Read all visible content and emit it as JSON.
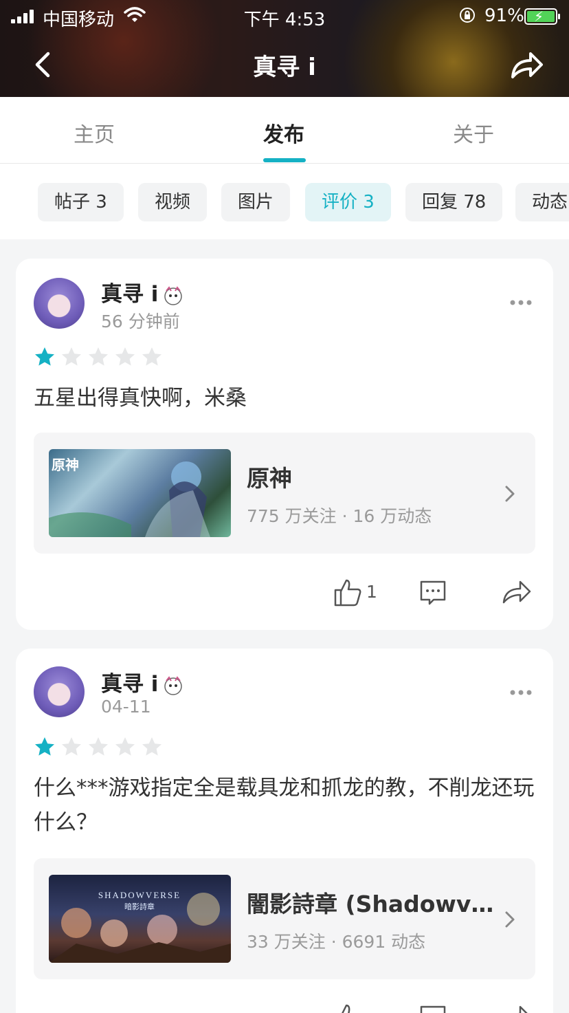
{
  "status": {
    "carrier": "中国移动",
    "time": "下午 4:53",
    "battery": "91%"
  },
  "header": {
    "title": "真寻 i"
  },
  "tabs": [
    "主页",
    "发布",
    "关于"
  ],
  "filters": [
    "帖子 3",
    "视频",
    "图片",
    "评价 3",
    "回复 78",
    "动态"
  ],
  "accent_color": "#15b1c4",
  "reviews": [
    {
      "user": "真寻 i",
      "time": "56 分钟前",
      "rating": 1,
      "text": "五星出得真快啊，米桑",
      "game": {
        "name": "原神",
        "stats": "775 万关注 · 16 万动态",
        "logo_text": "原神"
      },
      "likes": "1"
    },
    {
      "user": "真寻 i",
      "time": "04-11",
      "rating": 1,
      "text": "什么***游戏指定全是载具龙和抓龙的教，不削龙还玩什么？",
      "game": {
        "name": "闇影詩章 (Shadowverse)",
        "stats": "33 万关注 · 6691 动态",
        "logo_text": "SHADOWVERSE",
        "logo_sub": "暗影詩章"
      },
      "likes": ""
    }
  ]
}
